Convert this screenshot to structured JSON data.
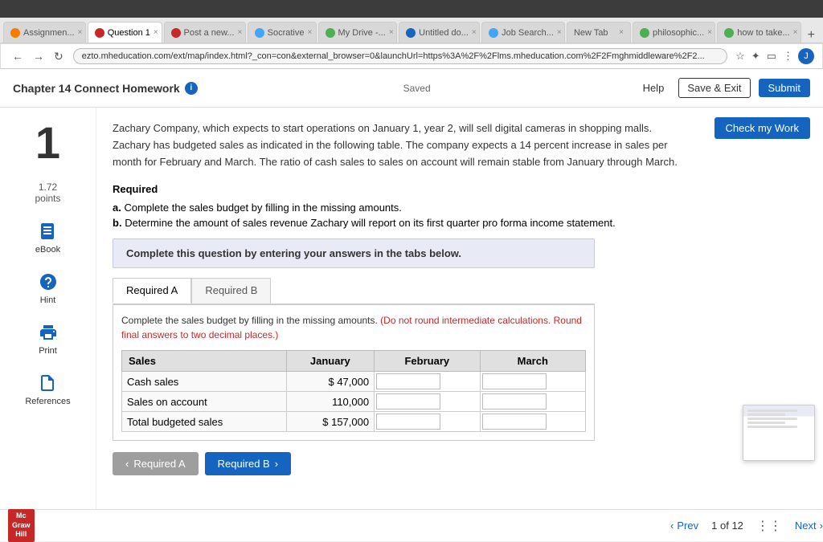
{
  "browser": {
    "tabs": [
      {
        "label": "Assignmen...",
        "active": false,
        "icon_color": "#f57c00"
      },
      {
        "label": "Question 1",
        "active": true,
        "icon_color": "#c62828"
      },
      {
        "label": "Post a new...",
        "active": false,
        "icon_color": "#c62828"
      },
      {
        "label": "Socrative",
        "active": false,
        "icon_color": "#42a5f5"
      },
      {
        "label": "My Drive -...",
        "active": false,
        "icon_color": "#4caf50"
      },
      {
        "label": "Untitled do...",
        "active": false,
        "icon_color": "#1565c0"
      },
      {
        "label": "Job Search...",
        "active": false,
        "icon_color": "#42a5f5"
      },
      {
        "label": "New Tab",
        "active": false,
        "icon_color": "#9e9e9e"
      },
      {
        "label": "philosophic...",
        "active": false,
        "icon_color": "#4caf50"
      },
      {
        "label": "how to take...",
        "active": false,
        "icon_color": "#4caf50"
      }
    ],
    "url": "ezto.mheducation.com/ext/map/index.html?_con=con&external_browser=0&launchUrl=https%3A%2F%2Flms.mheducation.com%2F2Fmghmiddleware%2F2..."
  },
  "header": {
    "title": "Chapter 14 Connect Homework",
    "saved_text": "Saved",
    "help_label": "Help",
    "save_exit_label": "Save & Exit",
    "submit_label": "Submit"
  },
  "question": {
    "number": "1",
    "points": "1.72",
    "points_label": "points",
    "check_work_label": "Check my Work",
    "body_text": "Zachary Company, which expects to start operations on January 1, year 2, will sell digital cameras in shopping malls. Zachary has budgeted sales as indicated in the following table. The company expects a 14 percent increase in sales per month for February and March. The ratio of cash sales to sales on account will remain stable from January through March.",
    "required_label": "Required",
    "req_a": "Complete the sales budget by filling in the missing amounts.",
    "req_b": "Determine the amount of sales revenue Zachary will report on its first quarter pro forma income statement.",
    "instruction_box": "Complete this question by entering your answers in the tabs below."
  },
  "tabs": {
    "tab_a_label": "Required A",
    "tab_b_label": "Required B"
  },
  "table": {
    "warning_normal": "Complete the sales budget by filling in the missing amounts. ",
    "warning_red": "(Do not round intermediate calculations. Round final answers to two decimal places.)",
    "col_sales": "Sales",
    "col_january": "January",
    "col_february": "February",
    "col_march": "March",
    "rows": [
      {
        "label": "Cash sales",
        "dollar_sign": "$",
        "jan_value": "47,000",
        "feb_value": "",
        "mar_value": ""
      },
      {
        "label": "Sales on account",
        "dollar_sign": "",
        "jan_value": "110,000",
        "feb_value": "",
        "mar_value": ""
      },
      {
        "label": "Total budgeted sales",
        "dollar_sign": "$",
        "jan_value": "157,000",
        "feb_value": "",
        "mar_value": ""
      }
    ]
  },
  "nav_buttons": {
    "req_a_label": "Required A",
    "req_b_label": "Required B"
  },
  "pagination": {
    "prev_label": "Prev",
    "next_label": "Next",
    "current_page": "1",
    "total_pages": "12",
    "of_label": "of"
  },
  "sidebar_tools": {
    "ebook_label": "eBook",
    "hint_label": "Hint",
    "print_label": "Print",
    "references_label": "References"
  }
}
